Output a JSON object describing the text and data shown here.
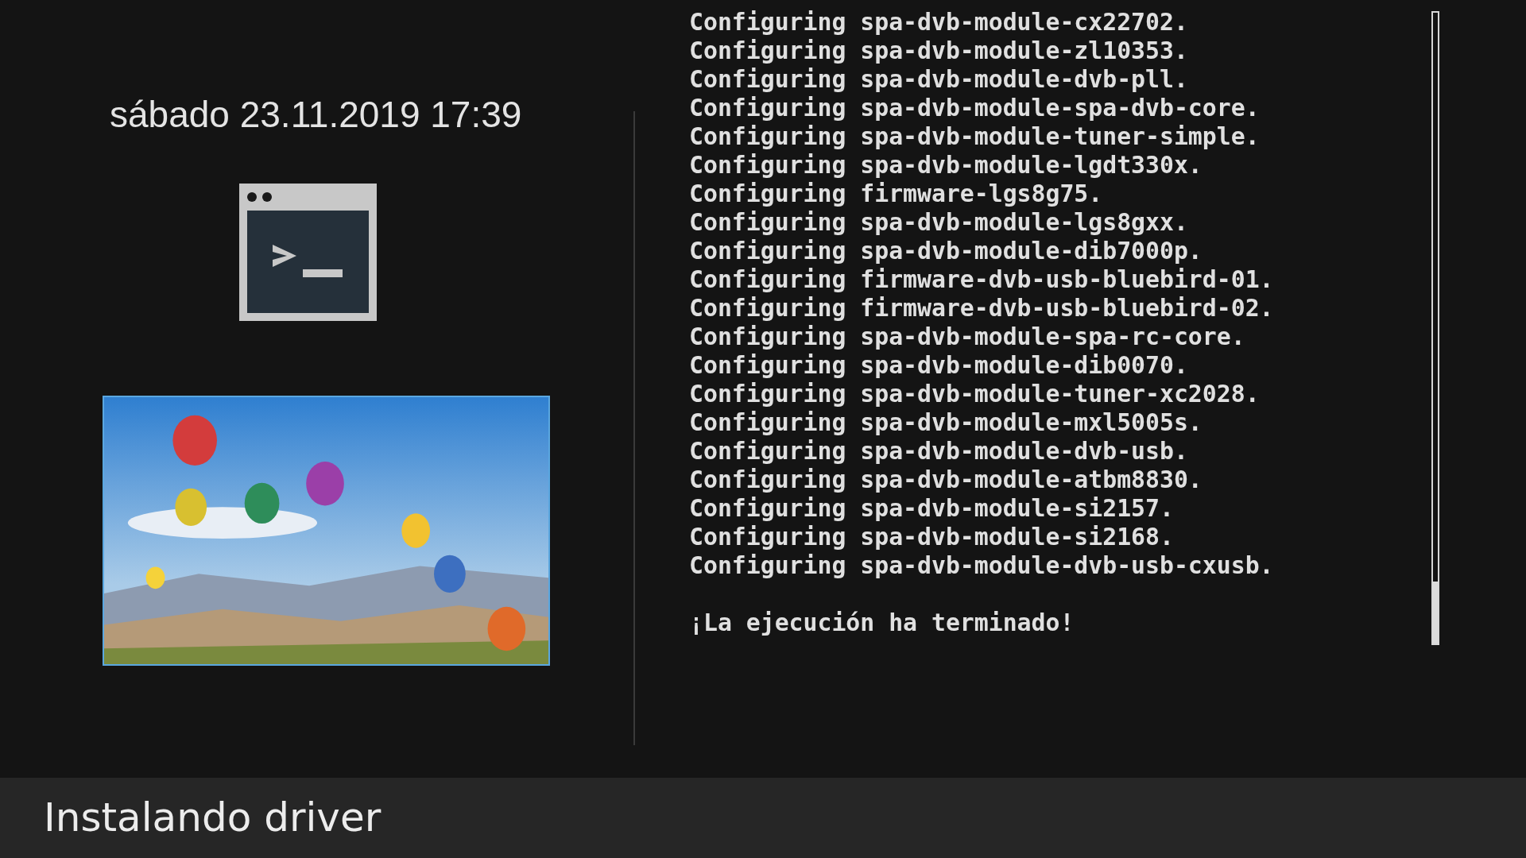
{
  "clock": "sábado 23.11.2019 17:39",
  "console": {
    "lines": [
      "Configuring spa-dvb-module-cx22702.",
      "Configuring spa-dvb-module-zl10353.",
      "Configuring spa-dvb-module-dvb-pll.",
      "Configuring spa-dvb-module-spa-dvb-core.",
      "Configuring spa-dvb-module-tuner-simple.",
      "Configuring spa-dvb-module-lgdt330x.",
      "Configuring firmware-lgs8g75.",
      "Configuring spa-dvb-module-lgs8gxx.",
      "Configuring spa-dvb-module-dib7000p.",
      "Configuring firmware-dvb-usb-bluebird-01.",
      "Configuring firmware-dvb-usb-bluebird-02.",
      "Configuring spa-dvb-module-spa-rc-core.",
      "Configuring spa-dvb-module-dib0070.",
      "Configuring spa-dvb-module-tuner-xc2028.",
      "Configuring spa-dvb-module-mxl5005s.",
      "Configuring spa-dvb-module-dvb-usb.",
      "Configuring spa-dvb-module-atbm8830.",
      "Configuring spa-dvb-module-si2157.",
      "Configuring spa-dvb-module-si2168.",
      "Configuring spa-dvb-module-dvb-usb-cxusb."
    ],
    "result": "¡La ejecución ha terminado!"
  },
  "status_bar": {
    "title": "Instalando driver"
  }
}
